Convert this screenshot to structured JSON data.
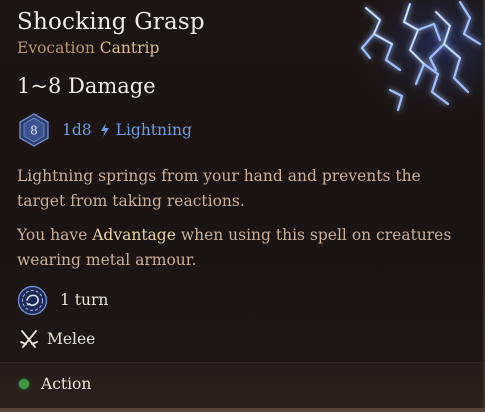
{
  "spell": {
    "title": "Shocking Grasp",
    "school": "Evocation",
    "level": "Cantrip",
    "damage": "1~8 Damage",
    "die_face": "8",
    "dice": "1d8",
    "damage_type": "Lightning"
  },
  "description": {
    "line1": "Lightning springs from your hand and prevents the target from taking reactions.",
    "line2_before": "You have ",
    "line2_highlight": "Advantage",
    "line2_after": " when using this spell on creatures wearing metal armour."
  },
  "properties": {
    "duration": "1 turn",
    "range": "Melee"
  },
  "footer": {
    "cost": "Action"
  },
  "icons": {
    "die": "d8-die-icon",
    "damage_type": "lightning-bolt-icon",
    "duration": "turn-duration-icon",
    "range": "crossed-swords-icon",
    "cost": "action-dot-icon"
  },
  "colors": {
    "title": "#f2ece4",
    "school": "#b9966a",
    "lightning": "#6f9de0",
    "highlight": "#e5d49f",
    "description": "#c9b19a",
    "action_dot": "#3f9a45"
  }
}
